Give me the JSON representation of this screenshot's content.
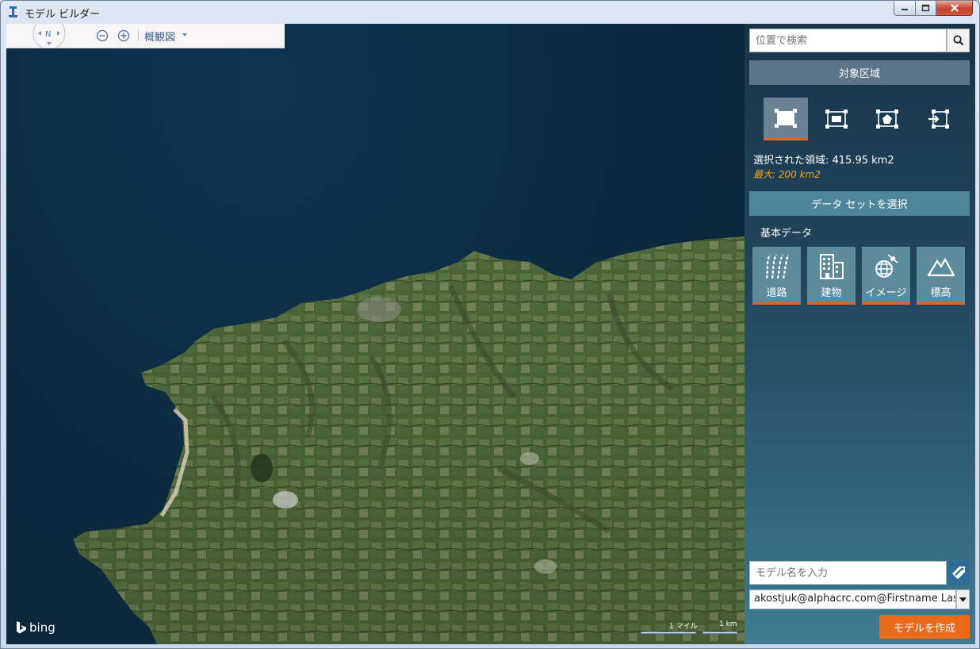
{
  "window": {
    "title": "モデル ビルダー"
  },
  "map": {
    "compass_label": "N",
    "view_mode": "概観図",
    "logo_text": "bing",
    "scale_miles": "1 マイル",
    "scale_km": "1 km"
  },
  "panel": {
    "search_placeholder": "位置で検索",
    "area_section_title": "対象区域",
    "selection_tools": [
      "rectangle-select",
      "fit-rectangle",
      "polygon-select",
      "import-area"
    ],
    "selected_area": "選択された領域: 415.95 km2",
    "max_area": "最大: 200 km2",
    "dataset_section_title": "データ セットを選択",
    "basic_data_label": "基本データ",
    "datasets": [
      {
        "label": "道路",
        "icon": "roads-icon"
      },
      {
        "label": "建物",
        "icon": "buildings-icon"
      },
      {
        "label": "イメージ",
        "icon": "imagery-icon"
      },
      {
        "label": "標高",
        "icon": "elevation-icon"
      }
    ],
    "model_name_placeholder": "モデル名を入力",
    "account": "akostjuk@alphacrc.com@Firstname Lastname",
    "create_button": "モデルを作成"
  },
  "colors": {
    "accent": "#ea6a1c",
    "warning": "#f4a21a",
    "section": "#5d7588"
  }
}
